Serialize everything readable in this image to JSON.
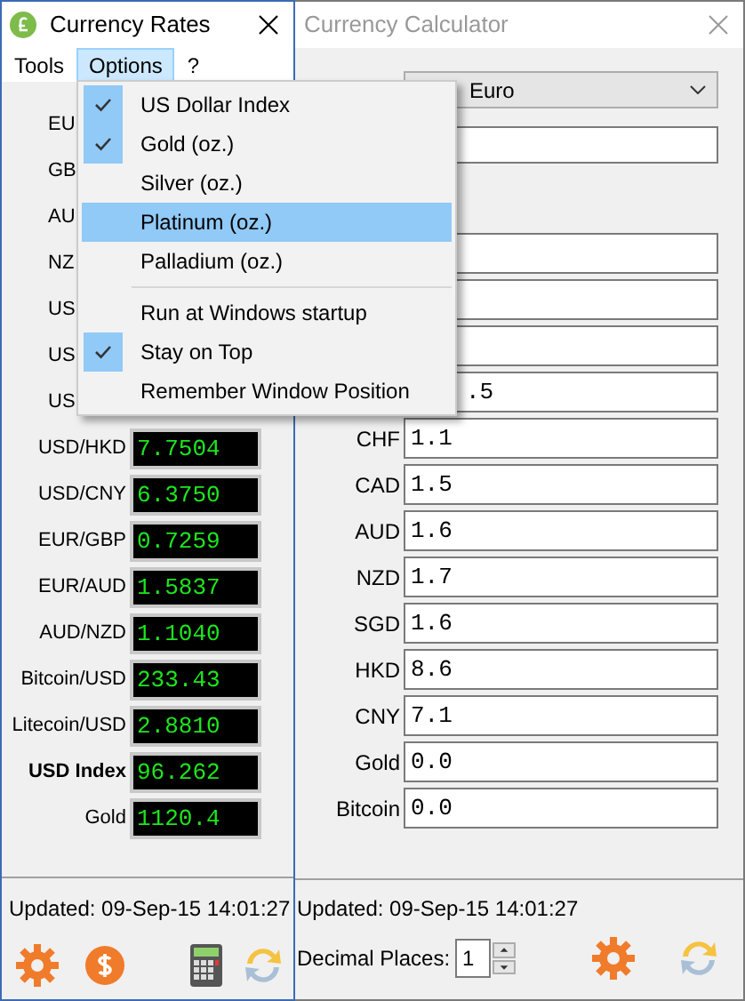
{
  "rates_window": {
    "title": "Currency Rates",
    "menu": [
      {
        "label": "Tools",
        "selected": false
      },
      {
        "label": "Options",
        "selected": true
      },
      {
        "label": "?",
        "selected": false
      }
    ],
    "rows": [
      {
        "label": "EU"
      },
      {
        "label": "GB"
      },
      {
        "label": "AU"
      },
      {
        "label": "NZ"
      },
      {
        "label": "US"
      },
      {
        "label": "US"
      },
      {
        "label": "US"
      },
      {
        "label": "USD/HKD",
        "value": "7.7504",
        "bold": false
      },
      {
        "label": "USD/CNY",
        "value": "6.3750",
        "bold": false
      },
      {
        "label": "EUR/GBP",
        "value": "0.7259",
        "bold": false
      },
      {
        "label": "EUR/AUD",
        "value": "1.5837",
        "bold": false
      },
      {
        "label": "AUD/NZD",
        "value": "1.1040",
        "bold": false
      },
      {
        "label": "Bitcoin/USD",
        "value": "233.43",
        "bold": false
      },
      {
        "label": "Litecoin/USD",
        "value": "2.8810",
        "bold": false
      },
      {
        "label": "USD Index",
        "value": "96.262",
        "bold": true
      },
      {
        "label": "Gold",
        "value": "1120.4",
        "bold": false
      }
    ],
    "updated": "Updated: 09-Sep-15 14:01:27"
  },
  "options_menu": {
    "items": [
      {
        "kind": "item",
        "label": "US Dollar Index",
        "checked": true,
        "selected": false
      },
      {
        "kind": "item",
        "label": "Gold (oz.)",
        "checked": true,
        "selected": false
      },
      {
        "kind": "item",
        "label": "Silver (oz.)",
        "checked": false,
        "selected": false
      },
      {
        "kind": "item",
        "label": "Platinum (oz.)",
        "checked": false,
        "selected": true
      },
      {
        "kind": "item",
        "label": "Palladium (oz.)",
        "checked": false,
        "selected": false
      },
      {
        "kind": "separator"
      },
      {
        "kind": "item",
        "label": "Run at Windows startup",
        "checked": false,
        "selected": false
      },
      {
        "kind": "item",
        "label": "Stay on Top",
        "checked": true,
        "selected": false
      },
      {
        "kind": "item",
        "label": "Remember Window Position",
        "checked": false,
        "selected": false
      }
    ]
  },
  "calculator_window": {
    "title": "Currency Calculator",
    "currency_dropdown": {
      "value": "Euro"
    },
    "rows": [
      {},
      {},
      {},
      {
        "value": ".5"
      },
      {
        "label": "CHF",
        "value": "1.1"
      },
      {
        "label": "CAD",
        "value": "1.5"
      },
      {
        "label": "AUD",
        "value": "1.6"
      },
      {
        "label": "NZD",
        "value": "1.7"
      },
      {
        "label": "SGD",
        "value": "1.6"
      },
      {
        "label": "HKD",
        "value": "8.6"
      },
      {
        "label": "CNY",
        "value": "7.1"
      },
      {
        "label": "Gold",
        "value": "0.0"
      },
      {
        "label": "Bitcoin",
        "value": "0.0"
      }
    ],
    "updated": "Updated: 09-Sep-15 14:01:27",
    "decimal_places": {
      "label": "Decimal Places:",
      "value": "1"
    }
  }
}
